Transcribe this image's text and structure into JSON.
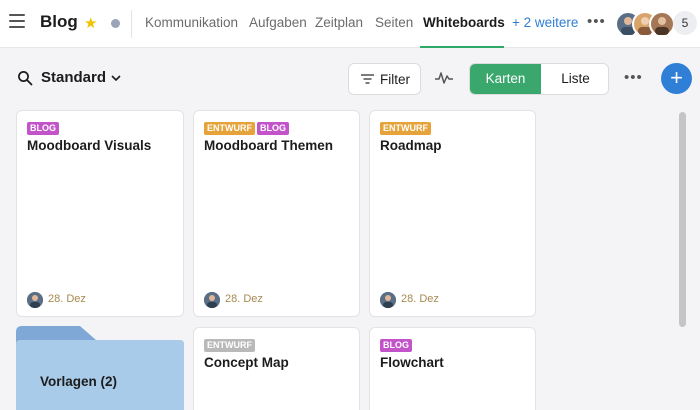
{
  "header": {
    "title": "Blog",
    "tabs": [
      {
        "label": "Kommunikation"
      },
      {
        "label": "Aufgaben"
      },
      {
        "label": "Zeitplan"
      },
      {
        "label": "Seiten"
      },
      {
        "label": "Whiteboards"
      },
      {
        "label": "+ 2 weitere"
      }
    ],
    "active_tab": "Whiteboards",
    "member_count": "5",
    "icons": {
      "menu": "hamburger-icon",
      "favorite": "star-icon",
      "status": "status-dot",
      "more": "more-dots-icon"
    }
  },
  "toolbar": {
    "view_name": "Standard",
    "filter_label": "Filter",
    "toggle": {
      "karten": "Karten",
      "liste": "Liste",
      "selected": "Karten"
    },
    "add_label": "+"
  },
  "cards": [
    {
      "tags": [
        "BLOG"
      ],
      "title": "Moodboard Visuals",
      "date": "28. Dez"
    },
    {
      "tags": [
        "ENTWURF",
        "BLOG"
      ],
      "title": "Moodboard Themen",
      "date": "28. Dez"
    },
    {
      "tags": [
        "ENTWURF"
      ],
      "title": "Roadmap",
      "date": "28. Dez"
    },
    {
      "tags": [
        "ENTWURF"
      ],
      "title": "Concept Map"
    },
    {
      "tags": [
        "BLOG"
      ],
      "title": "Flowchart"
    }
  ],
  "folder": {
    "title": "Vorlagen (2)"
  },
  "colors": {
    "accent_green": "#3aa76d",
    "add_blue": "#2f7fd6",
    "tag_blog": "#c253c9",
    "tag_entwurf": "#e5a33a",
    "tag_entwurf_grey": "#b9b9b9",
    "folder": "#a7cbe9"
  }
}
